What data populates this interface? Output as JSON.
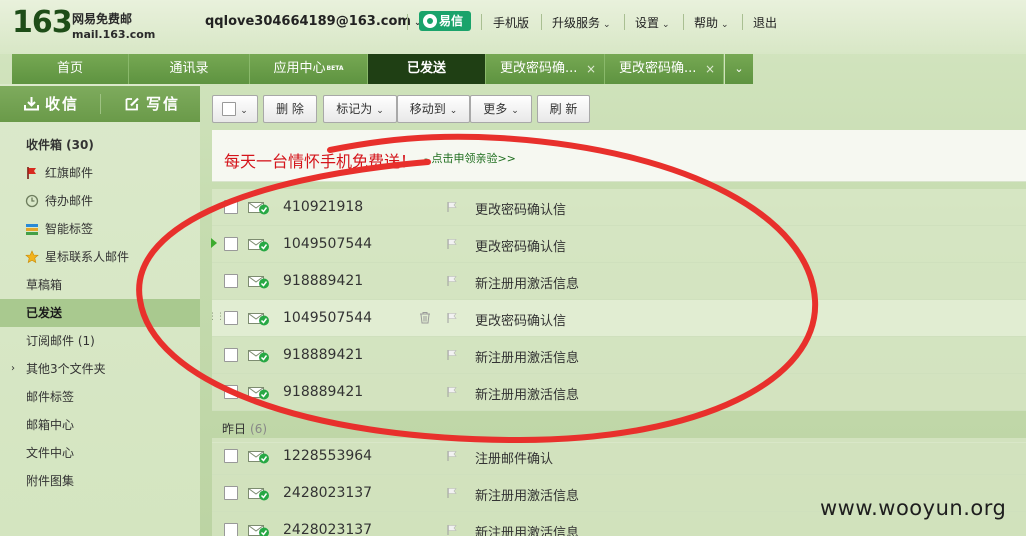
{
  "header": {
    "logo_number": "163",
    "logo_name": "网易免费邮",
    "logo_domain": "mail.163.com",
    "user_email": "qqlove304664189@163.com",
    "yixin_label": "易信",
    "links": [
      "手机版",
      "升级服务",
      "设置",
      "帮助",
      "退出"
    ]
  },
  "tabs": [
    {
      "label": "首页"
    },
    {
      "label": "通讯录"
    },
    {
      "label": "应用中心",
      "badge": "BETA"
    },
    {
      "label": "已发送",
      "active": true
    },
    {
      "label": "更改密码确...",
      "closable": true
    },
    {
      "label": "更改密码确...",
      "closable": true
    }
  ],
  "sidebar": {
    "receive_label": "收信",
    "compose_label": "写信",
    "items": [
      {
        "label": "收件箱 (30)",
        "bold": true
      },
      {
        "label": "红旗邮件",
        "icon": "red-flag-icon"
      },
      {
        "label": "待办邮件",
        "icon": "clock-icon"
      },
      {
        "label": "智能标签",
        "icon": "tag-icon"
      },
      {
        "label": "星标联系人邮件",
        "icon": "star-icon"
      },
      {
        "label": "草稿箱"
      },
      {
        "label": "已发送",
        "active": true
      },
      {
        "label": "订阅邮件 (1)"
      },
      {
        "label": "其他3个文件夹",
        "expandable": true
      },
      {
        "label": "邮件标签"
      },
      {
        "label": "邮箱中心"
      },
      {
        "label": "文件中心"
      },
      {
        "label": "附件图集"
      }
    ]
  },
  "toolbar": {
    "delete": "删 除",
    "mark_as": "标记为",
    "move_to": "移动到",
    "more": "更多",
    "refresh": "刷 新"
  },
  "promo": {
    "text": "每天一台情怀手机免费送！",
    "link": "- 点击申领亲验>>"
  },
  "today_rows": [
    {
      "from": "410921918",
      "subject": "更改密码确认信"
    },
    {
      "from": "1049507544",
      "subject": "更改密码确认信",
      "current": true
    },
    {
      "from": "918889421",
      "subject": "新注册用激活信息"
    },
    {
      "from": "1049507544",
      "subject": "更改密码确认信",
      "hovered": true
    },
    {
      "from": "918889421",
      "subject": "新注册用激活信息"
    },
    {
      "from": "918889421",
      "subject": "新注册用激活信息"
    }
  ],
  "yesterday": {
    "label": "昨日",
    "count": "(6)"
  },
  "yesterday_rows": [
    {
      "from": "1228553964",
      "subject": "注册邮件确认"
    },
    {
      "from": "2428023137",
      "subject": "新注册用激活信息"
    },
    {
      "from": "2428023137",
      "subject": "新注册用激活信息"
    }
  ],
  "watermark": "www.wooyun.org",
  "colors": {
    "accent_green": "#5e9340",
    "active_tab": "#1f3f14",
    "promo_red": "#d4141b",
    "annotation_red": "#e8302c"
  }
}
